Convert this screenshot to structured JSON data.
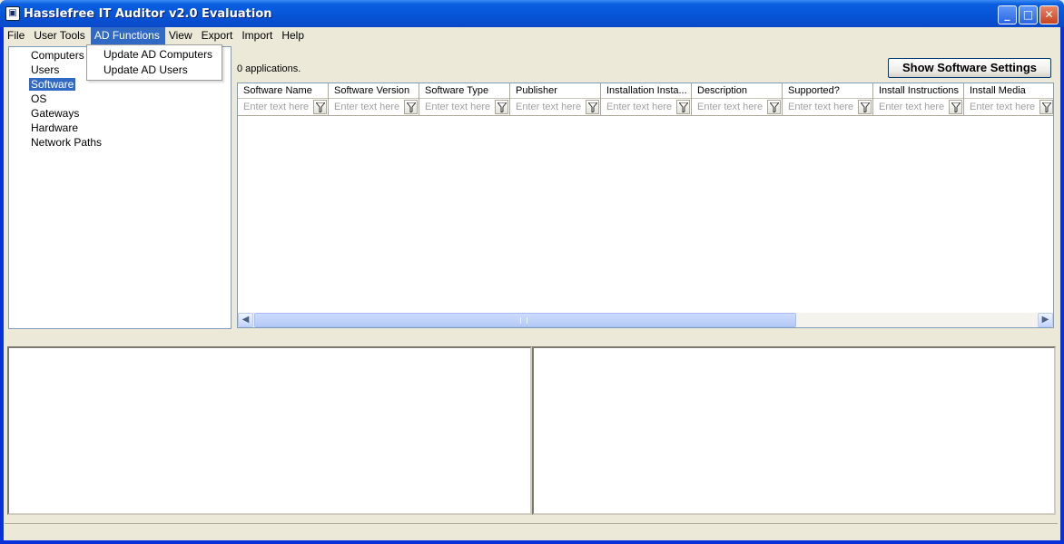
{
  "window": {
    "title": "Hasslefree IT Auditor v2.0 Evaluation",
    "minimize_label": "_",
    "maximize_label": "□",
    "close_label": "✕"
  },
  "menubar": {
    "items": [
      "File",
      "User Tools",
      "AD Functions",
      "View",
      "Export",
      "Import",
      "Help"
    ],
    "active": "AD Functions"
  },
  "ad_functions_menu": {
    "items": [
      "Update AD Computers",
      "Update AD Users"
    ]
  },
  "tree": {
    "items": [
      "Computers",
      "Users",
      "Software",
      "OS",
      "Gateways",
      "Hardware",
      "Network Paths"
    ],
    "selected": "Software"
  },
  "main": {
    "count_text": "0 applications.",
    "show_settings_label": "Show Software Settings"
  },
  "grid": {
    "columns": [
      "Software Name",
      "Software Version",
      "Software Type",
      "Publisher",
      "Installation Insta...",
      "Description",
      "Supported?",
      "Install Instructions",
      "Install Media"
    ],
    "filter_placeholder": "Enter text here",
    "rows": []
  },
  "icons": {
    "app": "monitor-icon",
    "filter": "funnel-icon",
    "scroll_left": "chevron-left-icon",
    "scroll_right": "chevron-right-icon"
  },
  "colors": {
    "titlebar": "#0653d6",
    "selection": "#316ac5",
    "background": "#ece9d8"
  }
}
